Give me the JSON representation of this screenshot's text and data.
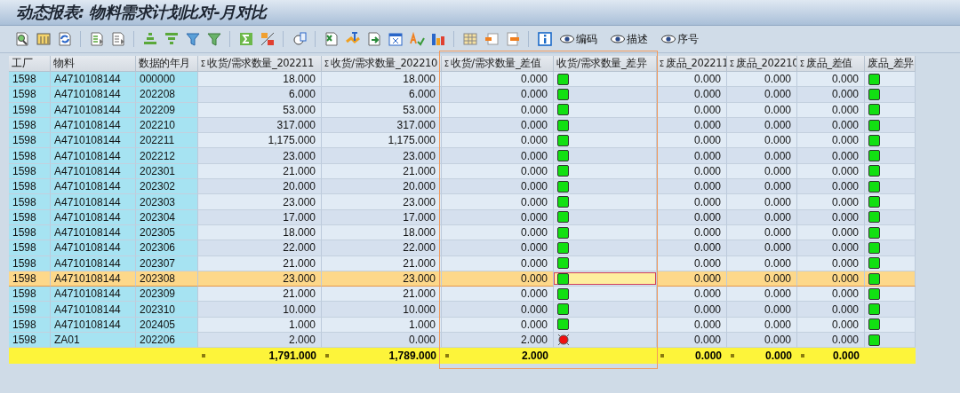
{
  "title": "动态报表: 物料需求计划比对-月对比",
  "toolbar": {
    "text_buttons": [
      "编码",
      "描述",
      "序号"
    ]
  },
  "table": {
    "columns": [
      {
        "label": "工厂",
        "kind": "key",
        "summed": false,
        "highlighted": false
      },
      {
        "label": "物料",
        "kind": "key",
        "summed": false,
        "highlighted": false
      },
      {
        "label": "数据的年月",
        "kind": "key",
        "summed": false,
        "highlighted": false
      },
      {
        "label": "收货/需求数量_202211",
        "kind": "number",
        "summed": true,
        "highlighted": false
      },
      {
        "label": "收货/需求数量_202210",
        "kind": "number",
        "summed": true,
        "highlighted": false
      },
      {
        "label": "收货/需求数量_差值",
        "kind": "number",
        "summed": true,
        "highlighted": true
      },
      {
        "label": "收货/需求数量_差异",
        "kind": "status",
        "summed": false,
        "highlighted": true
      },
      {
        "label": "废品_202211",
        "kind": "number",
        "summed": true,
        "highlighted": false
      },
      {
        "label": "废品_202210",
        "kind": "number",
        "summed": true,
        "highlighted": false
      },
      {
        "label": "废品_差值",
        "kind": "number",
        "summed": true,
        "highlighted": false
      },
      {
        "label": "废品_差异",
        "kind": "status",
        "summed": false,
        "highlighted": false
      }
    ],
    "rows": [
      {
        "selected": false,
        "focused": false,
        "values": [
          "1598",
          "A4710108144",
          "000000",
          "18.000",
          "18.000",
          "0.000",
          "0.000",
          "0.000",
          "0.000"
        ],
        "alerts": [
          false,
          false
        ]
      },
      {
        "selected": false,
        "focused": false,
        "values": [
          "1598",
          "A4710108144",
          "202208",
          "6.000",
          "6.000",
          "0.000",
          "0.000",
          "0.000",
          "0.000"
        ],
        "alerts": [
          false,
          false
        ]
      },
      {
        "selected": false,
        "focused": false,
        "values": [
          "1598",
          "A4710108144",
          "202209",
          "53.000",
          "53.000",
          "0.000",
          "0.000",
          "0.000",
          "0.000"
        ],
        "alerts": [
          false,
          false
        ]
      },
      {
        "selected": false,
        "focused": false,
        "values": [
          "1598",
          "A4710108144",
          "202210",
          "317.000",
          "317.000",
          "0.000",
          "0.000",
          "0.000",
          "0.000"
        ],
        "alerts": [
          false,
          false
        ]
      },
      {
        "selected": false,
        "focused": false,
        "values": [
          "1598",
          "A4710108144",
          "202211",
          "1,175.000",
          "1,175.000",
          "0.000",
          "0.000",
          "0.000",
          "0.000"
        ],
        "alerts": [
          false,
          false
        ]
      },
      {
        "selected": false,
        "focused": false,
        "values": [
          "1598",
          "A4710108144",
          "202212",
          "23.000",
          "23.000",
          "0.000",
          "0.000",
          "0.000",
          "0.000"
        ],
        "alerts": [
          false,
          false
        ]
      },
      {
        "selected": false,
        "focused": false,
        "values": [
          "1598",
          "A4710108144",
          "202301",
          "21.000",
          "21.000",
          "0.000",
          "0.000",
          "0.000",
          "0.000"
        ],
        "alerts": [
          false,
          false
        ]
      },
      {
        "selected": false,
        "focused": false,
        "values": [
          "1598",
          "A4710108144",
          "202302",
          "20.000",
          "20.000",
          "0.000",
          "0.000",
          "0.000",
          "0.000"
        ],
        "alerts": [
          false,
          false
        ]
      },
      {
        "selected": false,
        "focused": false,
        "values": [
          "1598",
          "A4710108144",
          "202303",
          "23.000",
          "23.000",
          "0.000",
          "0.000",
          "0.000",
          "0.000"
        ],
        "alerts": [
          false,
          false
        ]
      },
      {
        "selected": false,
        "focused": false,
        "values": [
          "1598",
          "A4710108144",
          "202304",
          "17.000",
          "17.000",
          "0.000",
          "0.000",
          "0.000",
          "0.000"
        ],
        "alerts": [
          false,
          false
        ]
      },
      {
        "selected": false,
        "focused": false,
        "values": [
          "1598",
          "A4710108144",
          "202305",
          "18.000",
          "18.000",
          "0.000",
          "0.000",
          "0.000",
          "0.000"
        ],
        "alerts": [
          false,
          false
        ]
      },
      {
        "selected": false,
        "focused": false,
        "values": [
          "1598",
          "A4710108144",
          "202306",
          "22.000",
          "22.000",
          "0.000",
          "0.000",
          "0.000",
          "0.000"
        ],
        "alerts": [
          false,
          false
        ]
      },
      {
        "selected": false,
        "focused": false,
        "values": [
          "1598",
          "A4710108144",
          "202307",
          "21.000",
          "21.000",
          "0.000",
          "0.000",
          "0.000",
          "0.000"
        ],
        "alerts": [
          false,
          false
        ]
      },
      {
        "selected": true,
        "focused": true,
        "values": [
          "1598",
          "A4710108144",
          "202308",
          "23.000",
          "23.000",
          "0.000",
          "0.000",
          "0.000",
          "0.000"
        ],
        "alerts": [
          false,
          false
        ]
      },
      {
        "selected": false,
        "focused": false,
        "values": [
          "1598",
          "A4710108144",
          "202309",
          "21.000",
          "21.000",
          "0.000",
          "0.000",
          "0.000",
          "0.000"
        ],
        "alerts": [
          false,
          false
        ]
      },
      {
        "selected": false,
        "focused": false,
        "values": [
          "1598",
          "A4710108144",
          "202310",
          "10.000",
          "10.000",
          "0.000",
          "0.000",
          "0.000",
          "0.000"
        ],
        "alerts": [
          false,
          false
        ]
      },
      {
        "selected": false,
        "focused": false,
        "values": [
          "1598",
          "A4710108144",
          "202405",
          "1.000",
          "1.000",
          "0.000",
          "0.000",
          "0.000",
          "0.000"
        ],
        "alerts": [
          false,
          false
        ]
      },
      {
        "selected": false,
        "focused": false,
        "values": [
          "1598",
          "ZA01",
          "202206",
          "2.000",
          "0.000",
          "2.000",
          "0.000",
          "0.000",
          "0.000"
        ],
        "alerts": [
          true,
          false
        ]
      }
    ],
    "totals": [
      "1,791.000",
      "1,789.000",
      "2.000",
      "0.000",
      "0.000",
      "0.000"
    ]
  }
}
